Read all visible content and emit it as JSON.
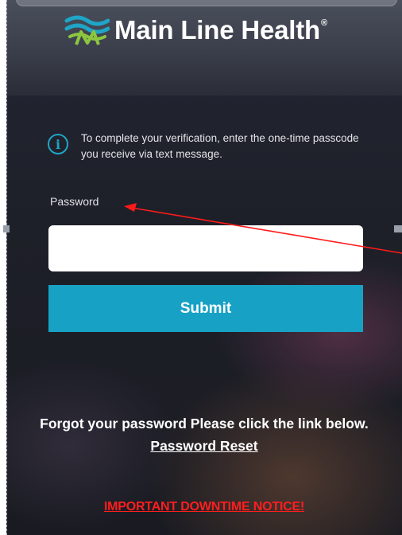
{
  "brand": {
    "name": "Main Line Health",
    "registered_mark": "®",
    "colors": {
      "teal": "#1fa5c6",
      "green": "#8cc63f",
      "alert_red": "#ff1e1e"
    }
  },
  "verification": {
    "info_icon": "info-circle-icon",
    "message": "To complete your verification, enter the one-time passcode you receive via text message."
  },
  "form": {
    "password_label": "Password",
    "password_value": "",
    "submit_label": "Submit"
  },
  "footer": {
    "forgot_text": "Forgot your password Please click the link below.",
    "reset_link": "Password Reset",
    "downtime_notice": "IMPORTANT DOWNTIME NOTICE!"
  },
  "annotation": {
    "type": "red-arrow-icon",
    "points_to": "password-label"
  }
}
